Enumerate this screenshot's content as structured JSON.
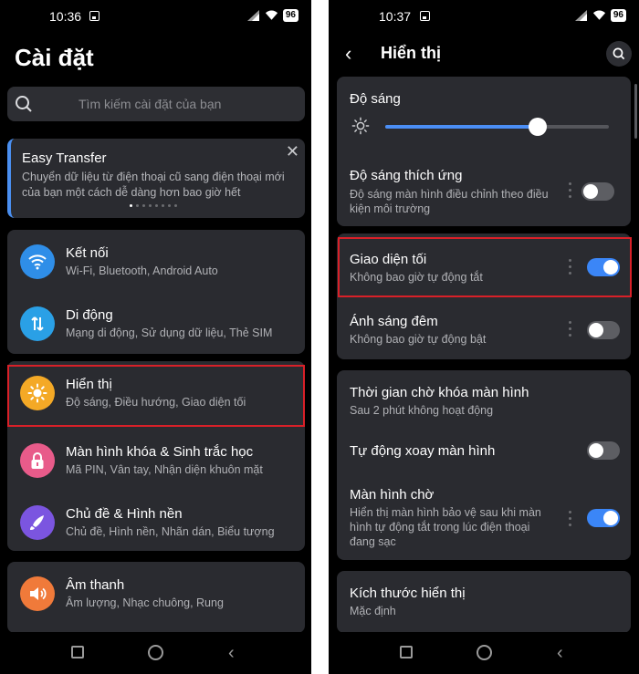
{
  "left": {
    "status": {
      "time": "10:36",
      "battery": "96"
    },
    "title": "Cài đặt",
    "search_placeholder": "Tìm kiếm cài đặt của bạn",
    "banner": {
      "title": "Easy Transfer",
      "desc": "Chuyển dữ liệu từ điện thoại cũ sang điện thoại mới của bạn một cách dễ dàng hơn bao giờ hết"
    },
    "items": [
      {
        "title": "Kết nối",
        "sub": "Wi-Fi, Bluetooth, Android Auto",
        "color": "#2f8ee8",
        "icon": "wifi-icon"
      },
      {
        "title": "Di động",
        "sub": "Mạng di động, Sử dụng dữ liệu, Thẻ SIM",
        "color": "#2aa0e6",
        "icon": "mobile-data-icon"
      },
      {
        "title": "Hiển thị",
        "sub": "Độ sáng, Điều hướng, Giao diện tối",
        "color": "#f4a926",
        "icon": "sun-icon"
      },
      {
        "title": "Màn hình khóa & Sinh trắc học",
        "sub": "Mã PIN, Vân tay, Nhận diện khuôn mặt",
        "color": "#e85b8a",
        "icon": "lock-icon"
      },
      {
        "title": "Chủ đề & Hình nền",
        "sub": "Chủ đề, Hình nền, Nhãn dán, Biểu tượng",
        "color": "#7b55e0",
        "icon": "theme-brush-icon"
      },
      {
        "title": "Âm thanh",
        "sub": "Âm lượng, Nhạc chuông, Rung",
        "color": "#f07a3a",
        "icon": "speaker-icon"
      }
    ]
  },
  "right": {
    "status": {
      "time": "10:37",
      "battery": "96"
    },
    "title": "Hiển thị",
    "brightness": {
      "label": "Độ sáng",
      "level": 0.68
    },
    "adaptive": {
      "title": "Độ sáng thích ứng",
      "sub": "Độ sáng màn hình điều chỉnh theo điều kiện môi trường",
      "on": false
    },
    "dark": {
      "title": "Giao diện tối",
      "sub": "Không bao giờ tự động tắt",
      "on": true
    },
    "night": {
      "title": "Ánh sáng đêm",
      "sub": "Không bao giờ tự động bật",
      "on": false
    },
    "timeout": {
      "title": "Thời gian chờ khóa màn hình",
      "sub": "Sau 2 phút không hoạt động"
    },
    "rotate": {
      "title": "Tự động xoay màn hình",
      "on": false
    },
    "screensaver": {
      "title": "Màn hình chờ",
      "sub": "Hiển thị màn hình bảo vệ sau khi màn hình tự động tắt trong lúc điện thoại đang sạc",
      "on": true
    },
    "size": {
      "title": "Kích thước hiển thị",
      "sub": "Mặc định"
    }
  },
  "colors": {
    "accent": "#3b86f7",
    "highlight": "#d92028"
  }
}
